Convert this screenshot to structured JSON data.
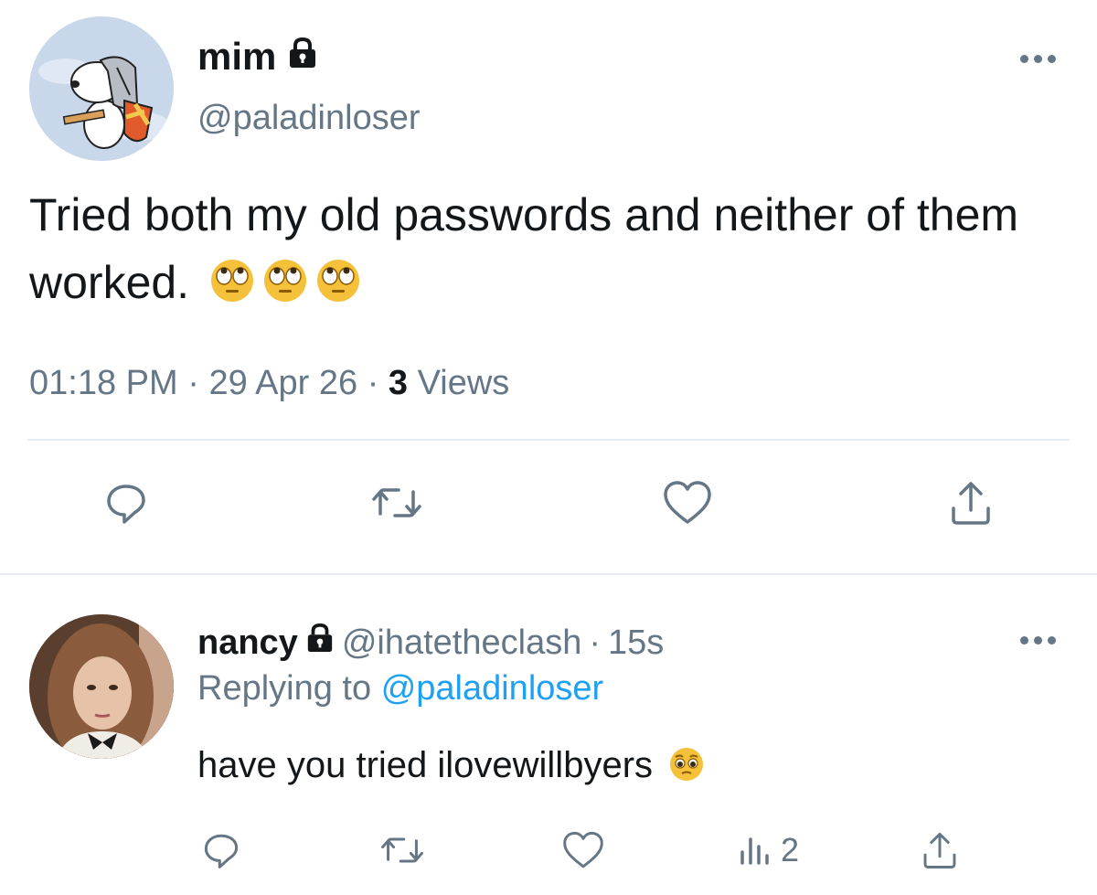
{
  "main_tweet": {
    "display_name": "mim",
    "handle": "@paladinloser",
    "text": "Tried both my old passwords and neither of them worked.",
    "time": "01:18 PM",
    "date": "29 Apr 26",
    "views_count": "3",
    "views_label": "Views",
    "separator": "·"
  },
  "reply": {
    "display_name": "nancy",
    "handle": "@ihatetheclash",
    "age": "15s",
    "replying_prefix": "Replying to",
    "replying_handle": "@paladinloser",
    "text": "have you tried ilovewillbyers",
    "views": "2",
    "separator": "·"
  },
  "icons": {
    "lock": "lock-icon",
    "more": "more-options-icon",
    "reply": "reply-icon",
    "retweet": "retweet-icon",
    "like": "like-icon",
    "share": "share-icon",
    "analytics": "analytics-icon",
    "eye_roll_emoji": "face-with-rolling-eyes",
    "pleading_emoji": "flushed-pleading-face"
  },
  "colors": {
    "text_primary": "#14171a",
    "text_secondary": "#657786",
    "link": "#1da1f2",
    "divider": "#e6ecf0",
    "emoji": "#f5c13a"
  }
}
